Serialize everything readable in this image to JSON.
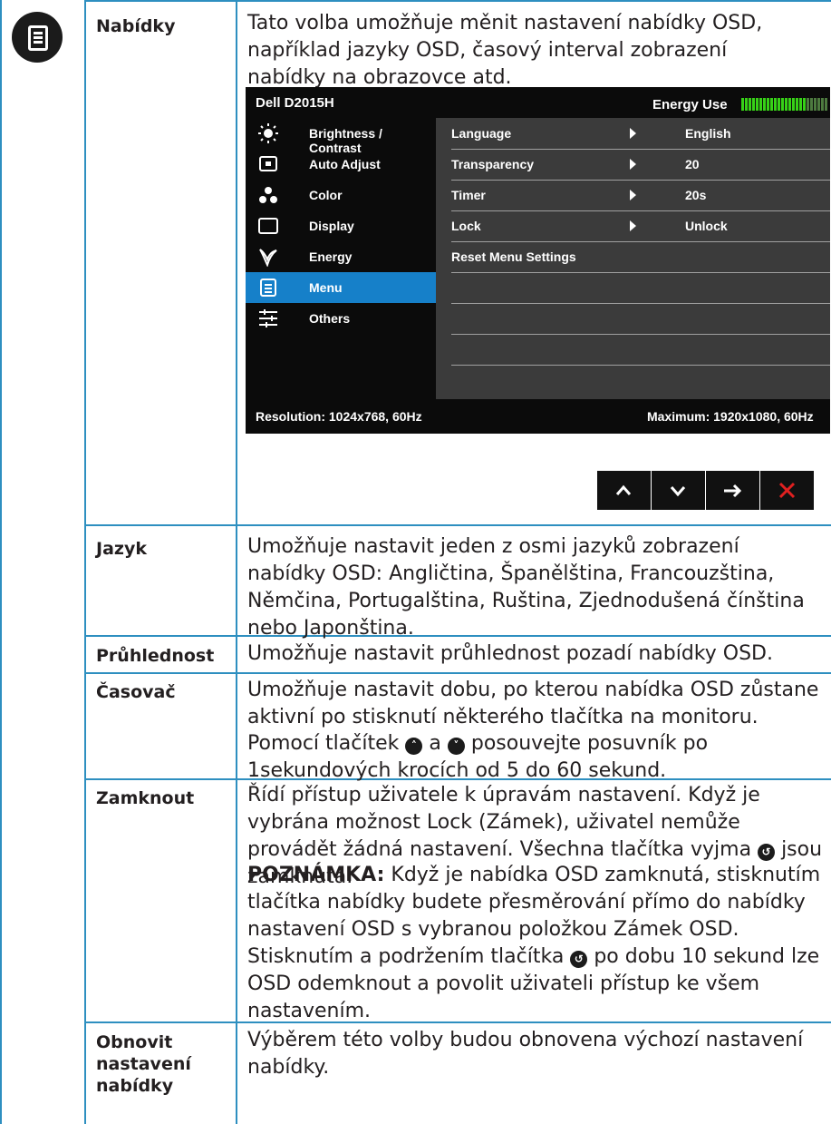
{
  "rows": [
    {
      "label": "Nabídky",
      "text": "Tato volba umožňuje měnit nastavení nabídky OSD, například jazyky OSD, časový interval zobrazení nabídky na obrazovce atd."
    },
    {
      "label": "Jazyk",
      "text": "Umožňuje nastavit jeden z osmi jazyků zobrazení nabídky OSD: Angličtina, Španělština, Francouzština, Němčina, Portugalština, Ruština, Zjednodušená čínština nebo Japonština."
    },
    {
      "label": "Průhlednost",
      "text": "Umožňuje nastavit průhlednost pozadí nabídky OSD."
    },
    {
      "label": "Časovač",
      "text": "Umožňuje nastavit dobu, po kterou nabídka OSD zůstane aktivní po stisknutí některého tlačítka na monitoru.",
      "text2_pre": "Pomocí tlačítek",
      "text2_mid": "a",
      "text2_post": "posouvejte posuvník po 1sekundových krocích od 5 do 60 sekund."
    },
    {
      "label": "Zamknout",
      "text_pre": "Řídí přístup uživatele k úpravám nastavení. Když je vybrána možnost Lock (Zámek), uživatel nemůže provádět žádná nastavení. Všechna tlačítka vyjma",
      "text_post": "jsou zamknutá.",
      "note_label": "POZNÁMKA:",
      "note_pre": "Když je nabídka OSD zamknutá, stisknutím tlačítka nabídky budete přesměrování přímo do nabídky nastavení OSD s vybranou položkou Zámek OSD. Stisknutím a podržením tlačítka",
      "note_post": "po dobu 10 sekund lze OSD odemknout a povolit uživateli přístup ke všem nastavením."
    },
    {
      "label": "Obnovit nastavení nabídky",
      "text": "Výběrem této volby budou obnovena výchozí nastavení nabídky."
    }
  ],
  "osd": {
    "model": "Dell D2015H",
    "energy_label": "Energy Use",
    "energy_level": 0.75,
    "menu": [
      {
        "label": "Brightness / Contrast",
        "icon": "brightness-icon"
      },
      {
        "label": "Auto Adjust",
        "icon": "auto-adjust-icon"
      },
      {
        "label": "Color",
        "icon": "color-icon"
      },
      {
        "label": "Display",
        "icon": "display-icon"
      },
      {
        "label": "Energy",
        "icon": "energy-icon"
      },
      {
        "label": "Menu",
        "icon": "menu-icon",
        "selected": true
      },
      {
        "label": "Others",
        "icon": "others-icon"
      }
    ],
    "settings": [
      {
        "key": "Language",
        "value": "English"
      },
      {
        "key": "Transparency",
        "value": "20"
      },
      {
        "key": "Timer",
        "value": "20s"
      },
      {
        "key": "Lock",
        "value": "Unlock"
      },
      {
        "key": "Reset Menu Settings",
        "value": ""
      }
    ],
    "resolution": "Resolution: 1024x768, 60Hz",
    "maximum": "Maximum: 1920x1080, 60Hz"
  },
  "nav_buttons": [
    "up-button",
    "down-button",
    "enter-button",
    "exit-button"
  ],
  "colors": {
    "rule": "#2e8fc0",
    "selection": "#1680c9",
    "energy": "#37d117",
    "exit": "#e02020"
  }
}
